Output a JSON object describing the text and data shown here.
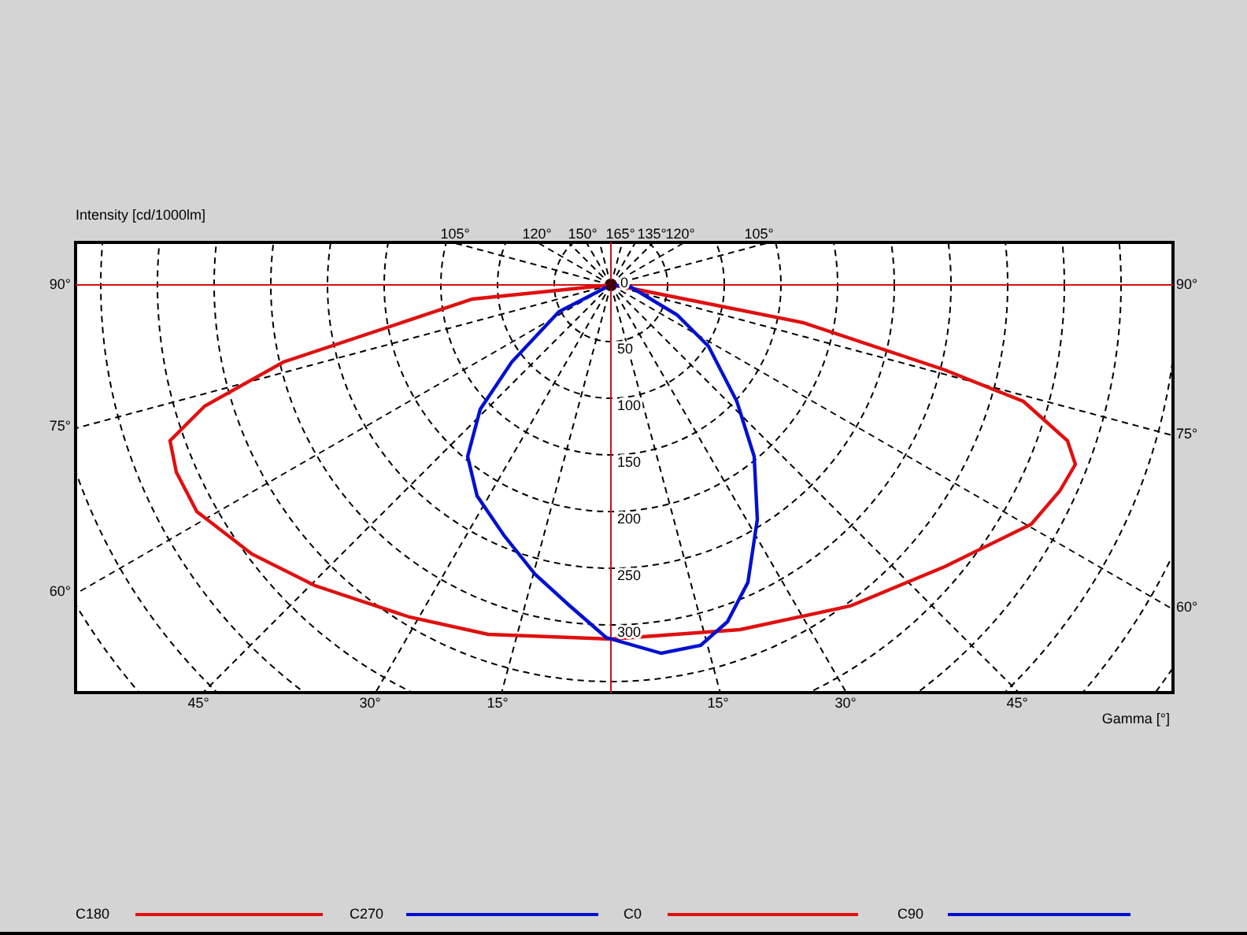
{
  "axis_title": "Intensity [cd/1000lm]",
  "top_angle_labels": [
    "105°",
    "120°",
    "150°",
    "165°",
    "135°",
    "120°",
    "105°"
  ],
  "ring_labels": [
    "0",
    "50",
    "100",
    "150",
    "200",
    "250",
    "300"
  ],
  "left_angle_labels": [
    "90°",
    "75°",
    "60°"
  ],
  "right_angle_labels": [
    "90°",
    "75°",
    "60°"
  ],
  "bottom_angle_labels": [
    "45°",
    "30°",
    "15°",
    "15°",
    "30°",
    "45°"
  ],
  "gamma_label": "Gamma [°]",
  "legend": [
    {
      "label": "C180",
      "color": "#e01010"
    },
    {
      "label": "C270",
      "color": "#0010d0"
    },
    {
      "label": "C0",
      "color": "#e01010"
    },
    {
      "label": "C90",
      "color": "#0010d0"
    }
  ]
}
